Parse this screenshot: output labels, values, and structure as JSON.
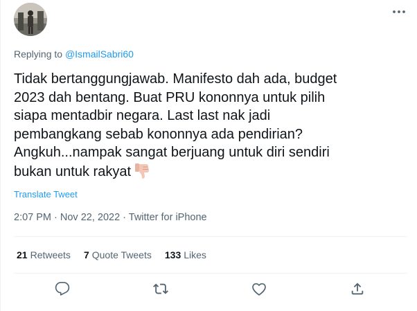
{
  "tweet": {
    "replying_prefix": "Replying to ",
    "replying_handle": "@IsmailSabri60",
    "text_lines": [
      "Tidak bertanggungjawab. Manifesto dah ada, budget",
      "2023 dah bentang. Buat PRU kononnya untuk pilih",
      "siapa mentadbir negara. Last last nak jadi",
      "pembangkang sebab kononnya ada pendirian?",
      "Angkuh...nampak sangat berjuang untuk diri sendiri",
      "bukan untuk rakyat"
    ],
    "emoji": "thumbs-down",
    "translate_label": "Translate Tweet",
    "time": "2:07 PM",
    "date": "Nov 22, 2022",
    "source": "Twitter for iPhone",
    "separator": " · "
  },
  "stats": {
    "retweets_count": "21",
    "retweets_label": "Retweets",
    "quotes_count": "7",
    "quotes_label": "Quote Tweets",
    "likes_count": "133",
    "likes_label": "Likes"
  },
  "icons": {
    "more": "more-horizontal-icon",
    "reply": "reply-icon",
    "retweet": "retweet-icon",
    "like": "heart-icon",
    "share": "share-icon"
  },
  "colors": {
    "link": "#1d9bf0",
    "muted": "#536471",
    "text": "#0f1419",
    "divider": "#eff3f4"
  }
}
